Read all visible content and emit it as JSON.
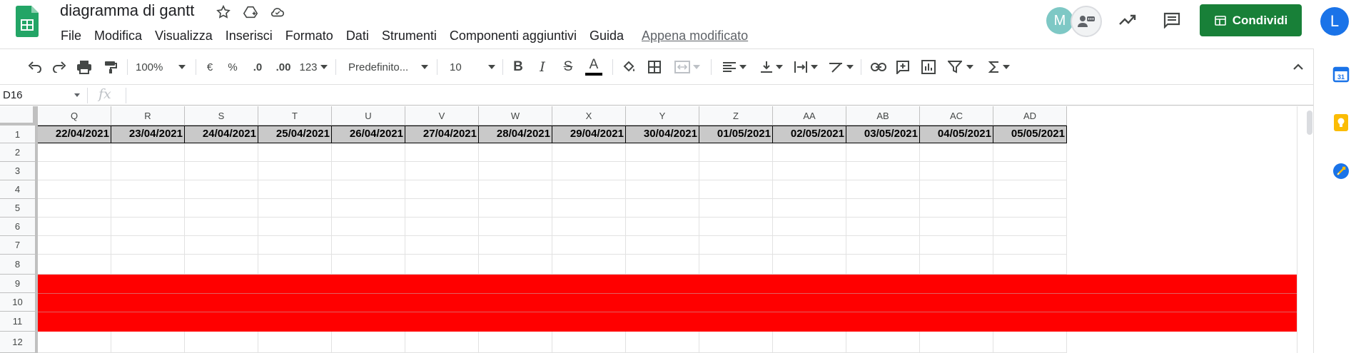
{
  "doc": {
    "title": "diagramma di gantt",
    "last_edit": "Appena modificato"
  },
  "menu": [
    "File",
    "Modifica",
    "Visualizza",
    "Inserisci",
    "Formato",
    "Dati",
    "Strumenti",
    "Componenti aggiuntivi",
    "Guida"
  ],
  "header": {
    "avatar_m": "M",
    "share_label": "Condividi",
    "account_initial": "L"
  },
  "toolbar": {
    "zoom": "100%",
    "currency": "€",
    "percent": "%",
    "dec_decrease": ".0",
    "dec_increase": ".00",
    "number_format": "123",
    "font": "Predefinito...",
    "font_size": "10",
    "bold": "B",
    "italic": "I",
    "strike": "S",
    "text_color": "A"
  },
  "formula_bar": {
    "name_box": "D16",
    "fx": "fx",
    "content": ""
  },
  "grid": {
    "columns": [
      "Q",
      "R",
      "S",
      "T",
      "U",
      "V",
      "W",
      "X",
      "Y",
      "Z",
      "AA",
      "AB",
      "AC",
      "AD"
    ],
    "rows": [
      "1",
      "2",
      "3",
      "4",
      "5",
      "6",
      "7",
      "8",
      "9",
      "10",
      "11",
      "12"
    ],
    "row1_dates": [
      "22/04/2021",
      "23/04/2021",
      "24/04/2021",
      "25/04/2021",
      "26/04/2021",
      "27/04/2021",
      "28/04/2021",
      "29/04/2021",
      "30/04/2021",
      "01/05/2021",
      "02/05/2021",
      "03/05/2021",
      "04/05/2021",
      "05/05/2021"
    ],
    "highlight_color": "#ff0000",
    "header_fill": "#c9c9c9"
  },
  "colors": {
    "share_button": "#188038",
    "account": "#1a73e8",
    "sheets_green": "#0f9d58"
  }
}
